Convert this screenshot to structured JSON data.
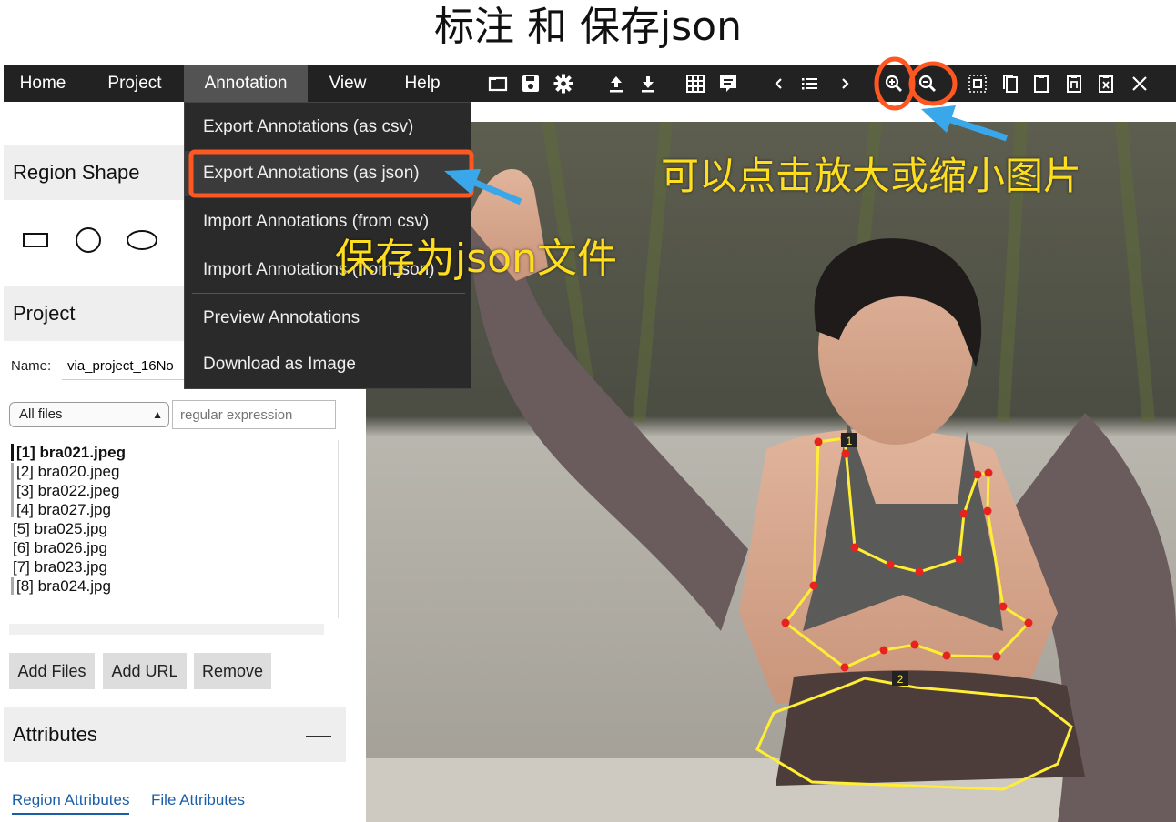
{
  "page": {
    "title": "标注 和 保存json"
  },
  "menubar": {
    "menus": [
      "Home",
      "Project",
      "Annotation",
      "View",
      "Help"
    ],
    "active": "Annotation"
  },
  "toolbar": {
    "icons": [
      "folder-icon",
      "save-icon",
      "gear-icon",
      "upload-icon",
      "download-icon",
      "grid-icon",
      "comment-icon",
      "prev-icon",
      "list-icon",
      "next-icon",
      "zoom-in-icon",
      "zoom-out-icon",
      "select-all-icon",
      "copy-icon",
      "paste-icon",
      "paste-n-icon",
      "paste-delete-icon",
      "close-icon"
    ]
  },
  "annotation_menu": {
    "items": [
      "Export Annotations (as csv)",
      "Export Annotations (as json)",
      "Import Annotations (from csv)",
      "Import Annotations (from json)",
      "Preview Annotations",
      "Download as Image"
    ],
    "highlighted": "Export Annotations (as json)"
  },
  "sidebar": {
    "region_shape": {
      "heading": "Region Shape",
      "shapes": [
        "rectangle-icon",
        "circle-icon",
        "ellipse-icon"
      ]
    },
    "project": {
      "heading": "Project",
      "name_label": "Name:",
      "name_value": "via_project_16No",
      "filter_value": "All files",
      "regex_placeholder": "regular expression",
      "files": [
        "[1] bra021.jpeg",
        "[2] bra020.jpeg",
        "[3] bra022.jpeg",
        "[4] bra027.jpg",
        "[5] bra025.jpg",
        "[6] bra026.jpg",
        "[7] bra023.jpg",
        "[8] bra024.jpg"
      ],
      "current_file": "[1] bra021.jpeg",
      "buttons": [
        "Add Files",
        "Add URL",
        "Remove"
      ]
    },
    "attributes": {
      "heading": "Attributes",
      "collapse_symbol": "—",
      "tabs": [
        "Region Attributes",
        "File Attributes"
      ],
      "active_tab": "Region Attributes"
    }
  },
  "canvas": {
    "region_labels": [
      "1",
      "2"
    ],
    "region_color": "#ffee33",
    "vertex_color": "#e8231f"
  },
  "callouts": {
    "zoom": "可以点击放大或缩小图片",
    "save_json": "保存为json文件"
  },
  "colors": {
    "menubar": "#222222",
    "highlight_box": "#ff5722",
    "arrow": "#3aa7ea",
    "callout_text": "#ffde1f"
  }
}
